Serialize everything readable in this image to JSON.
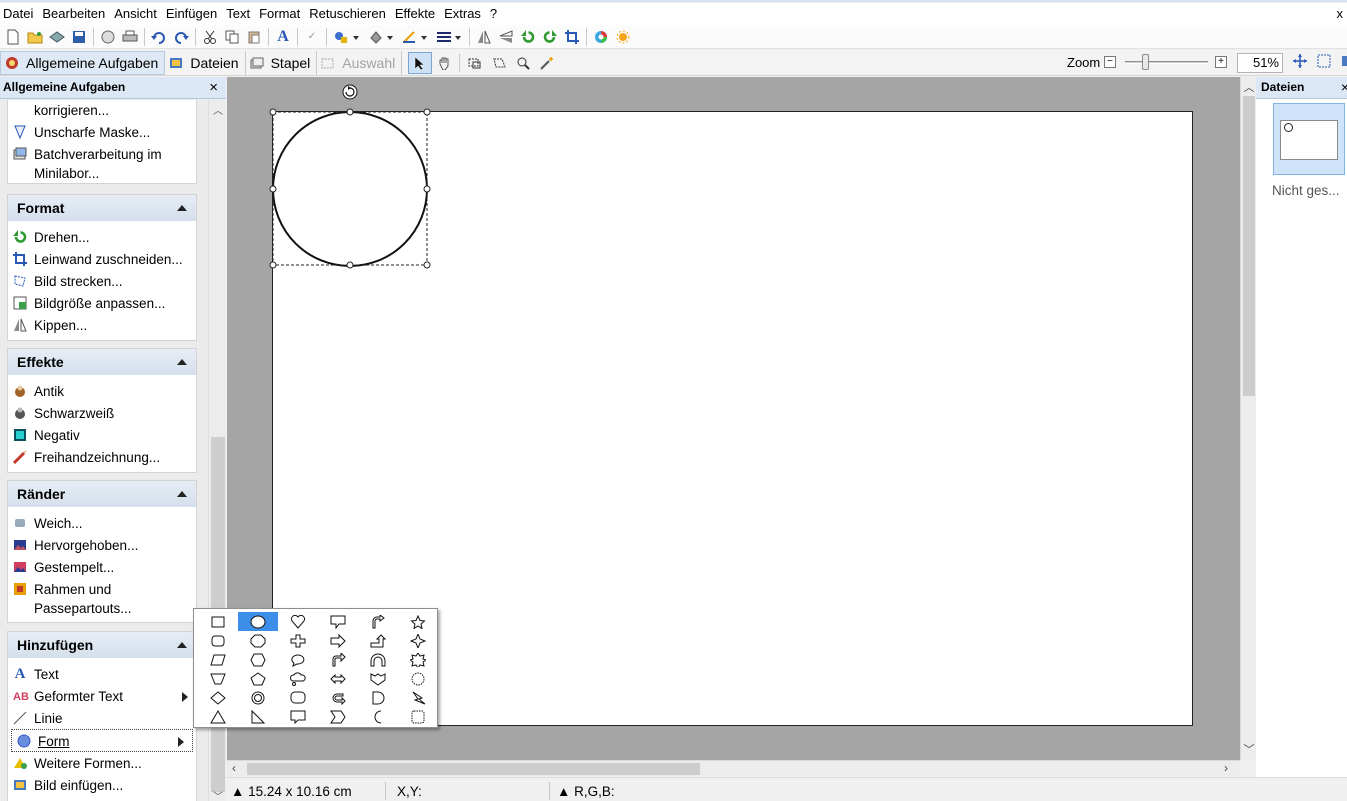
{
  "menu": [
    "Datei",
    "Bearbeiten",
    "Ansicht",
    "Einfügen",
    "Text",
    "Format",
    "Retuschieren",
    "Effekte",
    "Extras",
    "?"
  ],
  "window_close": "x",
  "tabs": [
    {
      "label": "Allgemeine Aufgaben",
      "active": true
    },
    {
      "label": "Dateien",
      "active": false
    },
    {
      "label": "Stapel",
      "active": false
    },
    {
      "label": "Auswahl",
      "active": false,
      "disabled": true
    }
  ],
  "zoom": {
    "label": "Zoom",
    "minus": "−",
    "plus": "+",
    "value": "51%",
    "level_percent": 51
  },
  "left_panel": {
    "title": "Allgemeine Aufgaben",
    "close": "×",
    "top_items": [
      "korrigieren...",
      "Unscharfe Maske...",
      "Batchverarbeitung im",
      "Minilabor..."
    ],
    "sections": [
      {
        "title": "Format",
        "items": [
          "Drehen...",
          "Leinwand zuschneiden...",
          "Bild strecken...",
          "Bildgröße anpassen...",
          "Kippen..."
        ]
      },
      {
        "title": "Effekte",
        "items": [
          "Antik",
          "Schwarzweiß",
          "Negativ",
          "Freihandzeichnung..."
        ]
      },
      {
        "title": "Ränder",
        "items": [
          "Weich...",
          "Hervorgehoben...",
          "Gestempelt...",
          "Rahmen und",
          "Passepartouts..."
        ]
      },
      {
        "title": "Hinzufügen",
        "items": [
          "Text",
          "Geformter Text",
          "Linie",
          "Form",
          "Weitere Formen...",
          "Bild einfügen..."
        ]
      }
    ]
  },
  "right_panel": {
    "title": "Dateien",
    "close": "×",
    "thumb_caption": "Nicht ges..."
  },
  "statusbar": {
    "size": "▲ 15.24 x 10.16 cm",
    "xy": "X,Y:",
    "rgb": "▲ R,G,B:"
  },
  "colors": {
    "selection_blue": "#3d8ee8",
    "panel_header": "#dbe7f4",
    "workspace": "#a5a5a5"
  }
}
